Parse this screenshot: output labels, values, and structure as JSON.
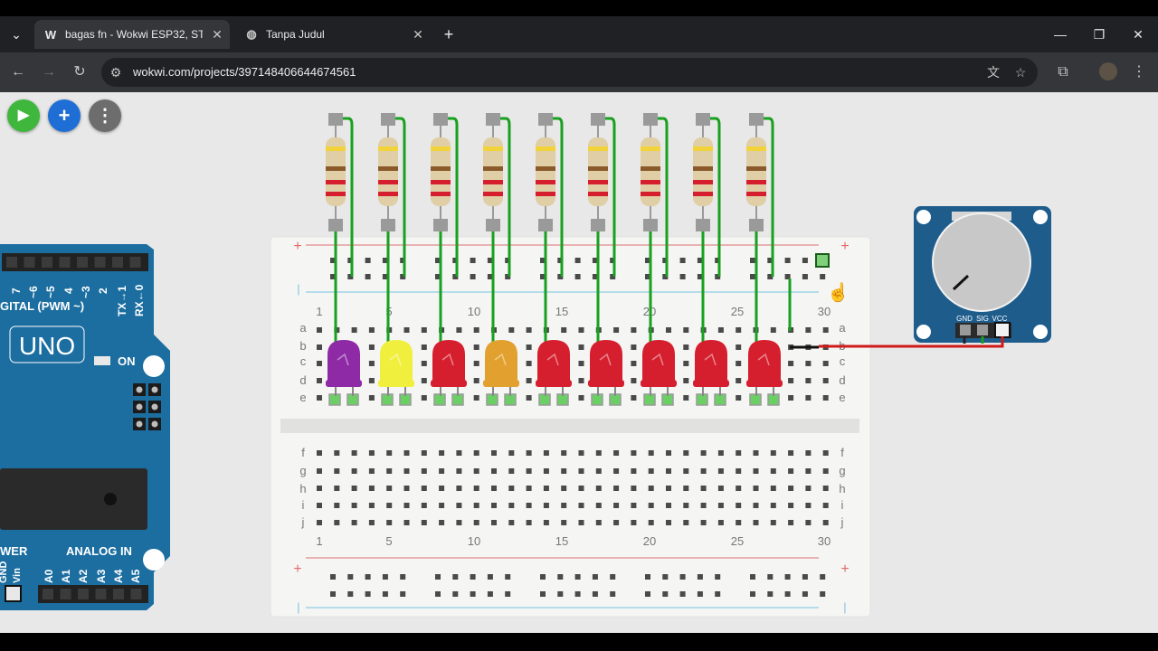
{
  "browser": {
    "tabs": [
      {
        "title": "bagas fn - Wokwi ESP32, STM32",
        "favicon": "W",
        "active": true
      },
      {
        "title": "Tanpa Judul",
        "favicon": "globe-icon",
        "active": false
      }
    ],
    "new_tab": "+",
    "url": "wokwi.com/projects/397148406644674561"
  },
  "toolbar": {
    "play": "▶",
    "add": "+",
    "more": "⋮"
  },
  "breadboard": {
    "col_numbers": [
      "1",
      "5",
      "10",
      "15",
      "20",
      "25",
      "30"
    ],
    "rows_top": [
      "a",
      "b",
      "c",
      "d",
      "e"
    ],
    "rows_bottom": [
      "f",
      "g",
      "h",
      "i",
      "j"
    ],
    "plus": "+",
    "minus": "|"
  },
  "arduino": {
    "pins_top": [
      "7",
      "~6",
      "~5",
      "4",
      "~3",
      "2",
      "TX→1",
      "RX←0"
    ],
    "digital_label": "GITAL (PWM ~)",
    "model": "UNO",
    "on_label": "ON",
    "power_label": "WER",
    "analog_label": "ANALOG IN",
    "power_pins": [
      "GND",
      "Vin"
    ],
    "analog_pins": [
      "A0",
      "A1",
      "A2",
      "A3",
      "A4",
      "A5"
    ]
  },
  "potentiometer": {
    "pins": [
      "GND",
      "SIG",
      "VCC"
    ]
  },
  "leds": [
    {
      "color": "#8e2aa6"
    },
    {
      "color": "#f1ef3e"
    },
    {
      "color": "#d61f2e"
    },
    {
      "color": "#e2a12f"
    },
    {
      "color": "#d61f2e"
    },
    {
      "color": "#d61f2e"
    },
    {
      "color": "#d61f2e"
    },
    {
      "color": "#d61f2e"
    },
    {
      "color": "#d61f2e"
    }
  ],
  "colors": {
    "wire_green": "#18a01f",
    "wire_red": "#d01b1b",
    "board_blue": "#1c6ea0",
    "pot_blue": "#1e5c8c"
  }
}
